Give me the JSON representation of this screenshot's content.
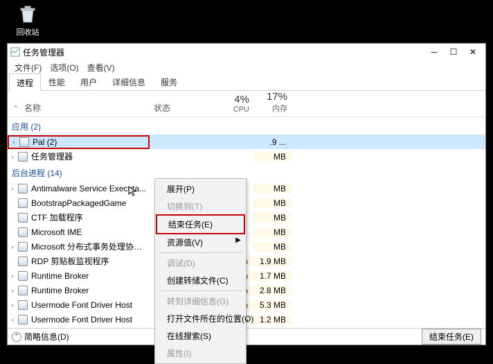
{
  "desktop": {
    "recycle_bin_label": "回收站"
  },
  "window": {
    "title": "任务管理器",
    "menubar": [
      "文件(F)",
      "选项(O)",
      "查看(V)"
    ],
    "tabs": [
      "进程",
      "性能",
      "用户",
      "详细信息",
      "服务"
    ],
    "columns": {
      "name": "名称",
      "status": "状态",
      "cpu_pct": "4%",
      "cpu_label": "CPU",
      "mem_pct": "17%",
      "mem_label": "内存"
    }
  },
  "groups": {
    "apps": "应用 (2)",
    "bg": "后台进程 (14)"
  },
  "processes": {
    "apps": [
      {
        "name": "Pal (2)",
        "cpu": "",
        "mem": ".9 ...",
        "expandable": true,
        "selected": true
      },
      {
        "name": "任务管理器",
        "cpu": "",
        "mem": "MB",
        "expandable": true
      }
    ],
    "bg": [
      {
        "name": "Antimalware Service Executa...",
        "cpu": "",
        "mem": "MB",
        "expandable": true
      },
      {
        "name": "BootstrapPackagedGame",
        "cpu": "",
        "mem": "MB"
      },
      {
        "name": "CTF 加载程序",
        "cpu": "",
        "mem": "MB"
      },
      {
        "name": "Microsoft IME",
        "cpu": "",
        "mem": "MB"
      },
      {
        "name": "Microsoft 分布式事务处理协调...",
        "cpu": "",
        "mem": "MB",
        "expandable": true
      },
      {
        "name": "RDP 剪贴板监视程序",
        "cpu": "0%",
        "mem": "1.9 MB"
      },
      {
        "name": "Runtime Broker",
        "cpu": "0%",
        "mem": "1.7 MB",
        "expandable": true
      },
      {
        "name": "Runtime Broker",
        "cpu": "0%",
        "mem": "2.8 MB",
        "expandable": true
      },
      {
        "name": "Usermode Font Driver Host",
        "cpu": "0%",
        "mem": "5.3 MB",
        "expandable": true
      },
      {
        "name": "Usermode Font Driver Host",
        "cpu": "0%",
        "mem": "1.2 MB",
        "expandable": true
      }
    ]
  },
  "context_menu": {
    "items": [
      {
        "label": "展开(P)",
        "enabled": true
      },
      {
        "label": "切换到(T)",
        "enabled": false
      },
      {
        "label": "结束任务(E)",
        "enabled": true,
        "highlight": true
      },
      {
        "label": "资源值(V)",
        "enabled": true,
        "submenu": true
      },
      {
        "sep": true
      },
      {
        "label": "调试(D)",
        "enabled": false
      },
      {
        "label": "创建转储文件(C)",
        "enabled": true
      },
      {
        "sep": true
      },
      {
        "label": "转到详细信息(G)",
        "enabled": false
      },
      {
        "label": "打开文件所在的位置(O)",
        "enabled": true
      },
      {
        "label": "在线搜索(S)",
        "enabled": true
      },
      {
        "label": "属性(I)",
        "enabled": false
      }
    ]
  },
  "statusbar": {
    "fewer_details": "简略信息(D)",
    "end_task": "结束任务(E)"
  }
}
